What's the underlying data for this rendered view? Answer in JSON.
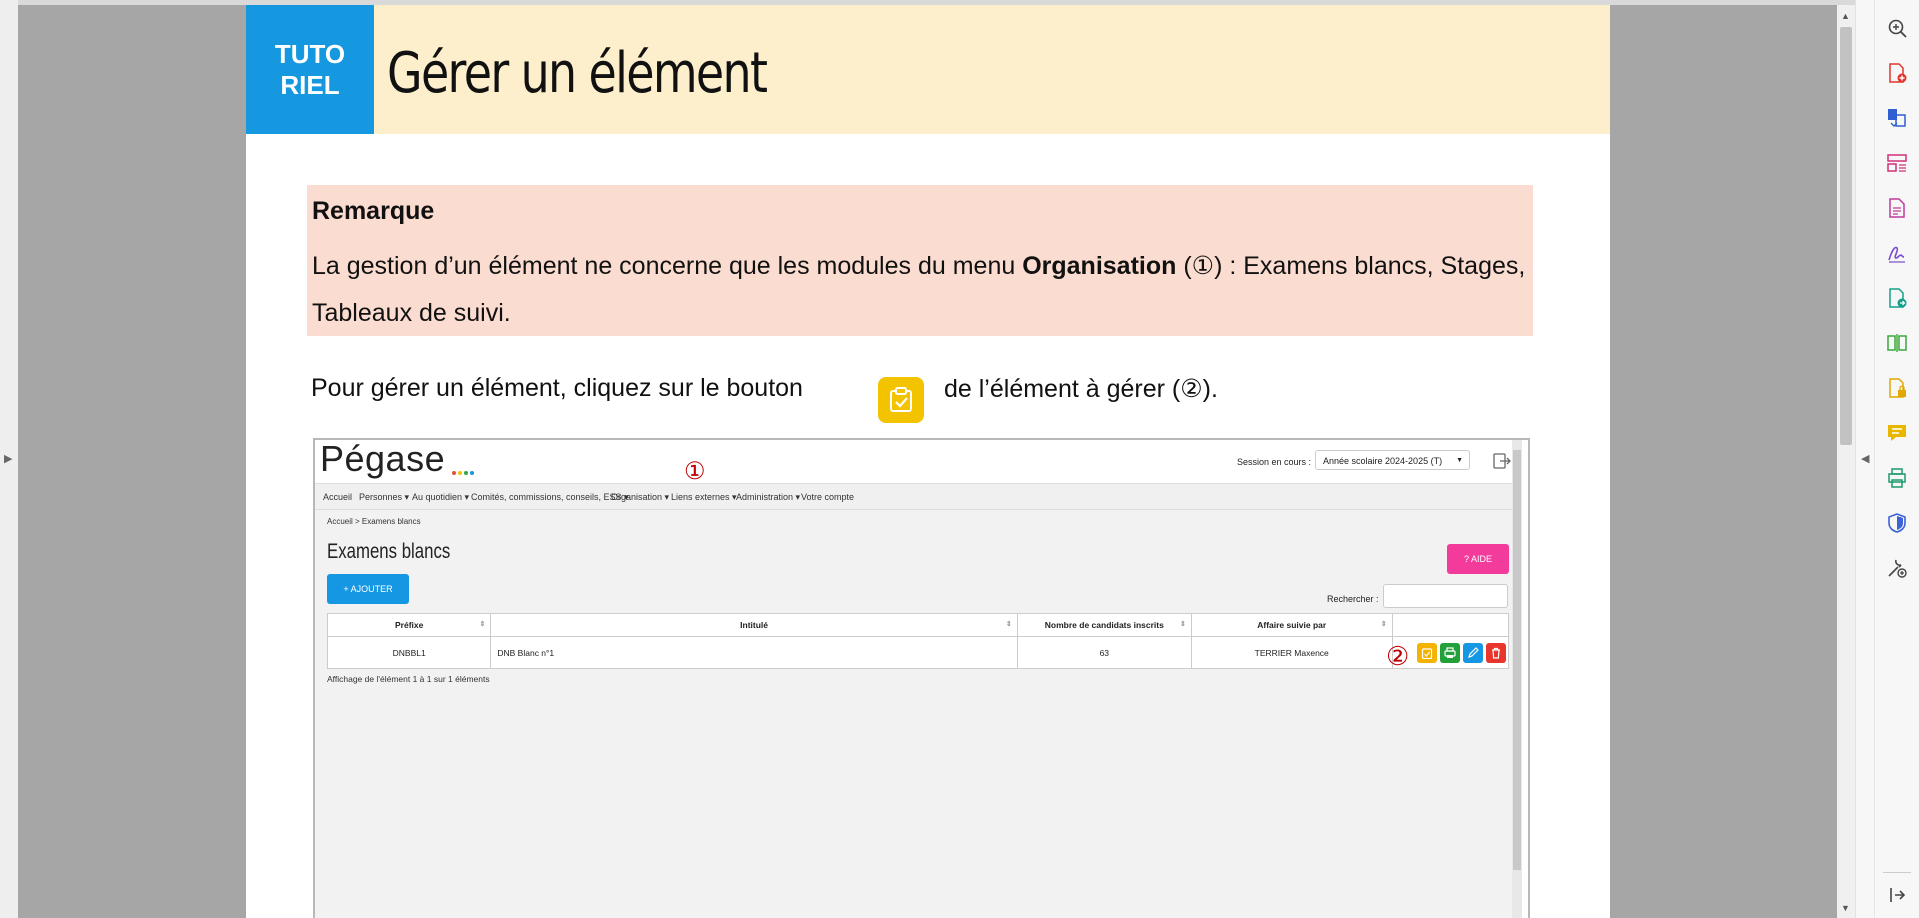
{
  "document": {
    "badge_line1": "TUTO",
    "badge_line2": "RIEL",
    "title": "Gérer un élément",
    "remark_title": "Remarque",
    "remark_text_before": "La gestion d’un élément ne concerne que les modules du menu ",
    "remark_bold": "Organisation",
    "remark_text_after": " (①) : Examens blancs, Stages, Tableaux de suivi.",
    "instruction_before": "Pour gérer un élément, cliquez sur le bouton",
    "instruction_after": "de l’élément à gérer (②).",
    "colors": {
      "badge": "#1598e0",
      "header_band": "#fdefcc",
      "remark_bg": "#fbdcd0",
      "manage_icon": "#f3c300"
    }
  },
  "app": {
    "logo": "Pégase",
    "logo_dot_colors": [
      "#e84d3c",
      "#f3c300",
      "#2ea84a",
      "#1597e3"
    ],
    "session_label": "Session en cours :",
    "session_value": "Année scolaire 2024-2025 (T)",
    "nav": [
      "Accueil",
      "Personnes ▾",
      "Au quotidien ▾",
      "Comités, commissions, conseils, ESS ▾",
      "Organisation ▾",
      "Liens externes ▾",
      "Administration ▾",
      "Votre compte"
    ],
    "breadcrumb": "Accueil > Examens blancs",
    "heading": "Examens blancs",
    "aide_label": "? AIDE",
    "ajouter_label": "+ AJOUTER",
    "search_label": "Rechercher :",
    "table": {
      "columns": [
        "Préfixe",
        "Intitulé",
        "Nombre de candidats inscrits",
        "Affaire suivie par",
        ""
      ],
      "rows": [
        {
          "prefixe": "DNBBL1",
          "intitule": "DNB Blanc n°1",
          "nombre": "63",
          "affaire": "TERRIER Maxence"
        }
      ]
    },
    "pagination": "Affichage de l'élément 1 à 1 sur 1 éléments",
    "marker_1": "①",
    "marker_2": "②",
    "action_colors": {
      "manage": "#f3b300",
      "print": "#22a03a",
      "edit": "#1597e3",
      "delete": "#e8362c"
    }
  }
}
